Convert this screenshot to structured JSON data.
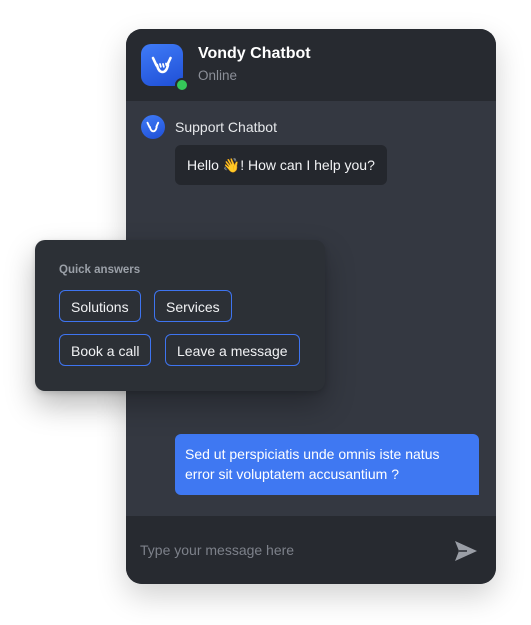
{
  "header": {
    "title": "Vondy Chatbot",
    "status": "Online"
  },
  "conversation": {
    "bot_name": "Support Chatbot",
    "bot_greeting": "Hello 👋! How can I help you?",
    "user_message": "Sed ut perspiciatis unde omnis iste natus error sit voluptatem accusantium ?"
  },
  "quick_answers": {
    "title": "Quick answers",
    "options": [
      "Solutions",
      "Services",
      "Book a call",
      "Leave a message"
    ]
  },
  "composer": {
    "placeholder": "Type your message here"
  },
  "icons": {
    "logo": "shaka-hand-icon",
    "send": "send-icon"
  },
  "colors": {
    "accent": "#3f78f2",
    "window_bg": "#343841",
    "header_bg": "#272a30",
    "online": "#35c759"
  }
}
